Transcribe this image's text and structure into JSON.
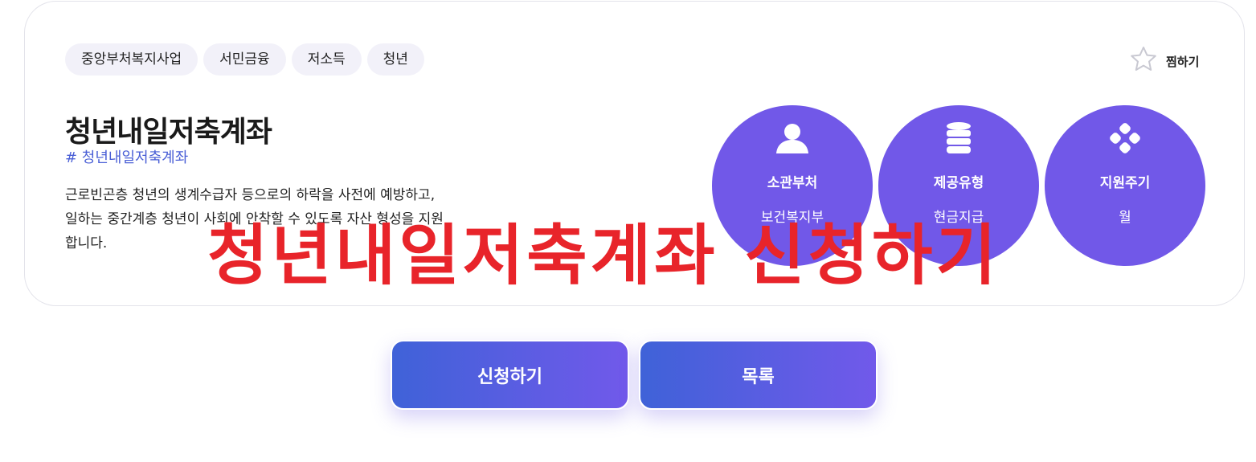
{
  "tags": [
    "중앙부처복지사업",
    "서민금융",
    "저소득",
    "청년"
  ],
  "favorite": {
    "label": "찜하기",
    "icon": "star-outline-icon"
  },
  "title": "청년내일저축계좌",
  "hashtag": "# 청년내일저축계좌",
  "description": "근로빈곤층 청년의 생계수급자 등으로의 하락을 사전에 예방하고, 일하는 중간계층 청년이 사회에 안착할 수 있도록 자산 형성을 지원합니다.",
  "info": [
    {
      "icon": "person-icon",
      "label": "소관부처",
      "value": "보건복지부"
    },
    {
      "icon": "coin-stack-icon",
      "label": "제공유형",
      "value": "현금지급"
    },
    {
      "icon": "cycle-dots-icon",
      "label": "지원주기",
      "value": "월"
    }
  ],
  "overlay_text": "청년내일저축계좌 신청하기",
  "buttons": {
    "apply": "신청하기",
    "list": "목록"
  },
  "colors": {
    "accent": "#7158e8",
    "overlay": "#e8242a",
    "hashtag": "#4a5fd6"
  }
}
